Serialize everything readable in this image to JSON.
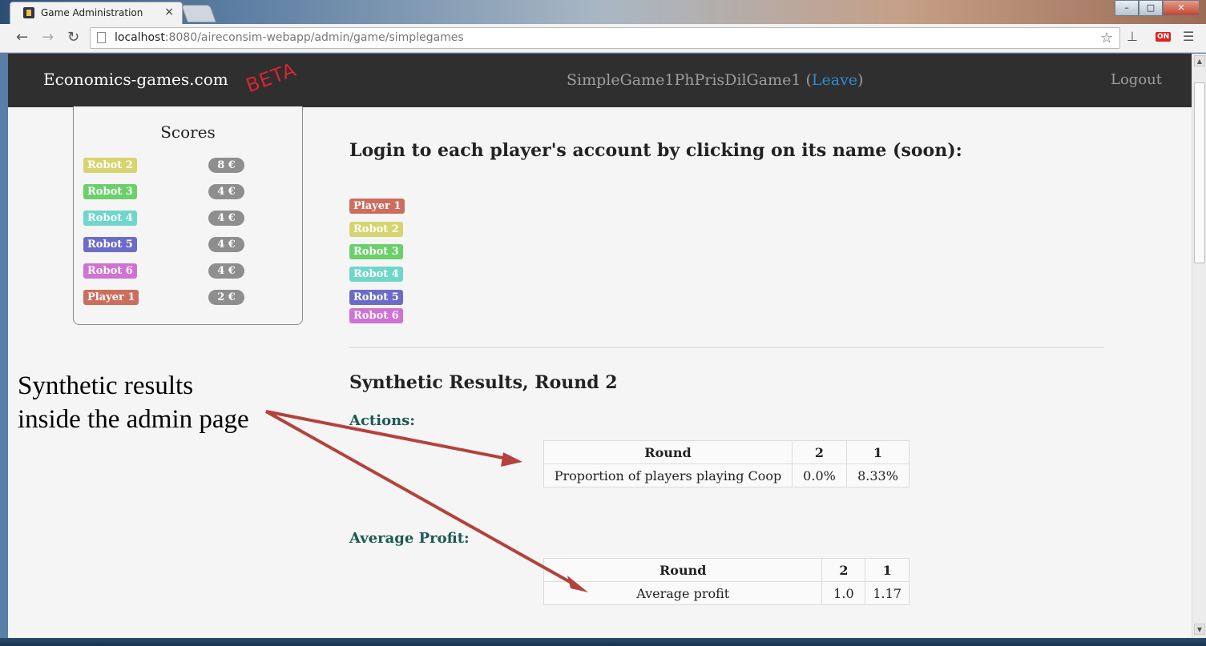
{
  "browser": {
    "tab_title": "Game Administration",
    "tab_close": "×",
    "url_host": "localhost",
    "url_path": ":8080/aireconsim-webapp/admin/game/simplegames",
    "on_badge": "ON",
    "window_buttons": [
      "–",
      "□",
      "✕"
    ]
  },
  "navbar": {
    "brand": "Economics-games.com",
    "beta": "BETA",
    "game_name": "SimpleGame1PhPrisDilGame1",
    "leave_open": "(",
    "leave_label": "Leave",
    "leave_close": ")",
    "logout": "Logout"
  },
  "scores": {
    "title": "Scores",
    "rows": [
      {
        "name": "Robot 2",
        "score": "8 €",
        "color": "#d6d46f"
      },
      {
        "name": "Robot 3",
        "score": "4 €",
        "color": "#6bd06b"
      },
      {
        "name": "Robot 4",
        "score": "4 €",
        "color": "#6fd6cc"
      },
      {
        "name": "Robot 5",
        "score": "4 €",
        "color": "#6c6cc6"
      },
      {
        "name": "Robot 6",
        "score": "4 €",
        "color": "#d072d2"
      },
      {
        "name": "Player 1",
        "score": "2 €",
        "color": "#cc6e5e"
      }
    ]
  },
  "main": {
    "login_heading": "Login to each player's account by clicking on its name (soon):",
    "players": [
      {
        "name": "Player 1",
        "color": "#cc6e5e"
      },
      {
        "name": "Robot 2",
        "color": "#d6d46f"
      },
      {
        "name": "Robot 3",
        "color": "#6bd06b"
      },
      {
        "name": "Robot 4",
        "color": "#6fd6cc"
      },
      {
        "name": "Robot 5",
        "color": "#6c6cc6"
      },
      {
        "name": "Robot 6",
        "color": "#d072d2"
      }
    ],
    "synthetic_heading": "Synthetic Results, Round 2",
    "actions_heading": "Actions:",
    "actions_table": {
      "headers": [
        "Round",
        "2",
        "1"
      ],
      "row": [
        "Proportion of players playing Coop",
        "0.0%",
        "8.33%"
      ]
    },
    "profit_heading": "Average Profit:",
    "profit_table": {
      "headers": [
        "Round",
        "2",
        "1"
      ],
      "row": [
        "Average profit",
        "1.0",
        "1.17"
      ]
    }
  },
  "annotation": {
    "line1": "Synthetic results",
    "line2": "inside the admin page"
  },
  "colors": {
    "navbar_bg": "#2f2f2f",
    "link": "#2e8bd0",
    "beta": "#d8262d",
    "subheading": "#1b5a52",
    "arrow": "#b3423c"
  }
}
